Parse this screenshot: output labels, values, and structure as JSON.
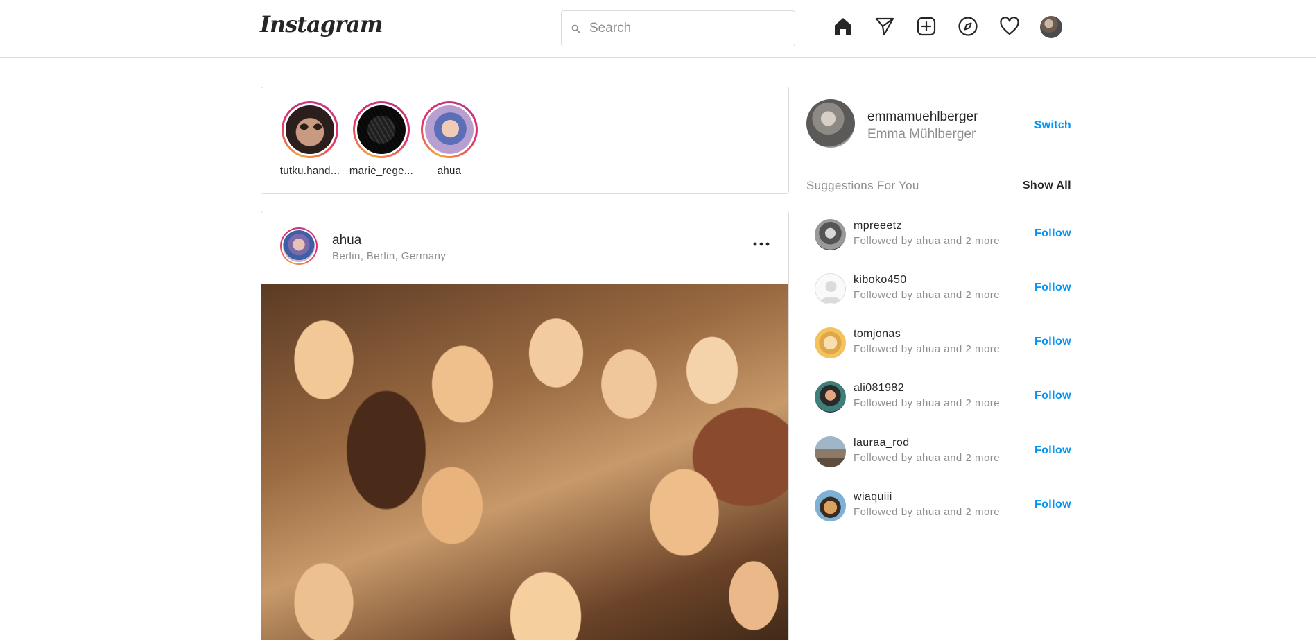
{
  "header": {
    "logo_text": "Instagram",
    "search": {
      "placeholder": "Search",
      "value": ""
    },
    "icons": [
      "home-icon",
      "direct-icon",
      "new-post-icon",
      "explore-icon",
      "activity-icon",
      "profile-avatar"
    ]
  },
  "stories": [
    {
      "username": "tutku.hand..."
    },
    {
      "username": "marie_rege..."
    },
    {
      "username": "ahua"
    }
  ],
  "post": {
    "username": "ahua",
    "location": "Berlin, Berlin, Germany"
  },
  "sidebar": {
    "profile": {
      "username": "emmamuehlberger",
      "full_name": "Emma Mühlberger",
      "switch_label": "Switch"
    },
    "suggestions_title": "Suggestions For You",
    "show_all_label": "Show All",
    "suggestions": [
      {
        "username": "mpreeetz",
        "meta": "Followed by ahua and 2 more",
        "action": "Follow"
      },
      {
        "username": "kiboko450",
        "meta": "Followed by ahua and 2 more",
        "action": "Follow"
      },
      {
        "username": "tomjonas",
        "meta": "Followed by ahua and 2 more",
        "action": "Follow"
      },
      {
        "username": "ali081982",
        "meta": "Followed by ahua and 2 more",
        "action": "Follow"
      },
      {
        "username": "lauraa_rod",
        "meta": "Followed by ahua and 2 more",
        "action": "Follow"
      },
      {
        "username": "wiaquiii",
        "meta": "Followed by ahua and 2 more",
        "action": "Follow"
      }
    ]
  },
  "colors": {
    "accent": "#0095f6",
    "text": "#262626",
    "muted": "#8e8e8e",
    "border": "#dbdbdb"
  }
}
